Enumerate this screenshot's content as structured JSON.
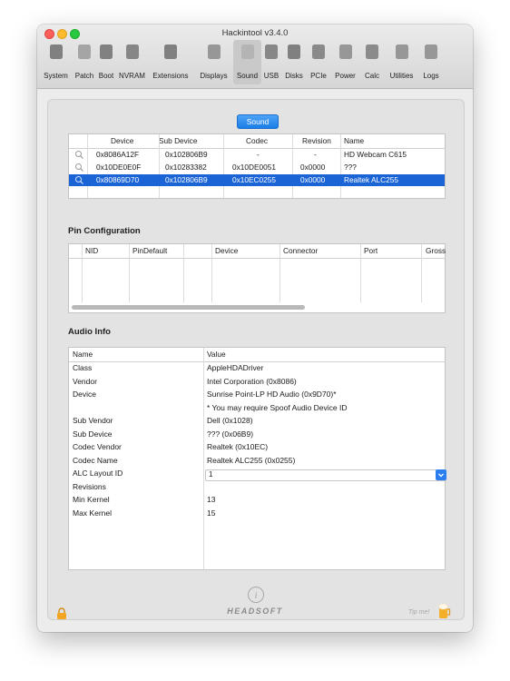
{
  "window": {
    "title": "Hackintool v3.4.0"
  },
  "toolbar": {
    "items": [
      {
        "label": "System",
        "icon": "system-icon"
      },
      {
        "label": "Patch",
        "icon": "patch-icon"
      },
      {
        "label": "Boot",
        "icon": "boot-icon"
      },
      {
        "label": "NVRAM",
        "icon": "nvram-icon"
      },
      {
        "label": "Extensions",
        "icon": "extensions-icon"
      },
      {
        "label": "Displays",
        "icon": "displays-icon"
      },
      {
        "label": "Sound",
        "icon": "sound-icon",
        "active": true
      },
      {
        "label": "USB",
        "icon": "usb-icon"
      },
      {
        "label": "Disks",
        "icon": "disks-icon"
      },
      {
        "label": "PCIe",
        "icon": "pcie-icon"
      },
      {
        "label": "Power",
        "icon": "power-icon"
      },
      {
        "label": "Calc",
        "icon": "calc-icon"
      },
      {
        "label": "Utilities",
        "icon": "utilities-icon"
      },
      {
        "label": "Logs",
        "icon": "logs-icon"
      }
    ]
  },
  "tab": {
    "label": "Sound"
  },
  "devices": {
    "headers": [
      "Device",
      "Sub Device",
      "Codec",
      "Revision",
      "Name"
    ],
    "rows": [
      {
        "device": "0x8086A12F",
        "sub_device": "0x102806B9",
        "codec": "-",
        "revision": "-",
        "name": "HD Webcam C615",
        "selected": false
      },
      {
        "device": "0x10DE0E0F",
        "sub_device": "0x10283382",
        "codec": "0x10DE0051",
        "revision": "0x0000",
        "name": "???",
        "selected": false
      },
      {
        "device": "0x80869D70",
        "sub_device": "0x102806B9",
        "codec": "0x10EC0255",
        "revision": "0x0000",
        "name": "Realtek ALC255",
        "selected": true
      }
    ]
  },
  "pin_config": {
    "title": "Pin Configuration",
    "headers": [
      "NID",
      "PinDefault",
      "Device",
      "Connector",
      "Port",
      "Gross"
    ]
  },
  "audio_info": {
    "title": "Audio Info",
    "headers": [
      "Name",
      "Value"
    ],
    "rows": [
      {
        "name": "Class",
        "value": "AppleHDADriver"
      },
      {
        "name": "Vendor",
        "value": "Intel Corporation (0x8086)"
      },
      {
        "name": "Device",
        "value": "Sunrise Point-LP HD Audio (0x9D70)*"
      },
      {
        "name": "",
        "value": "* You may require Spoof Audio Device ID"
      },
      {
        "name": "Sub Vendor",
        "value": "Dell (0x1028)"
      },
      {
        "name": "Sub Device",
        "value": "??? (0x06B9)"
      },
      {
        "name": "Codec Vendor",
        "value": "Realtek (0x10EC)"
      },
      {
        "name": "Codec Name",
        "value": "Realtek ALC255 (0x0255)"
      },
      {
        "name": "ALC Layout ID",
        "value": "1",
        "dropdown": true
      },
      {
        "name": "Revisions",
        "value": ""
      },
      {
        "name": "Min Kernel",
        "value": "13"
      },
      {
        "name": "Max Kernel",
        "value": "15"
      }
    ]
  },
  "footer": {
    "brand": "HEADSOFT",
    "tip": "Tip me!"
  }
}
